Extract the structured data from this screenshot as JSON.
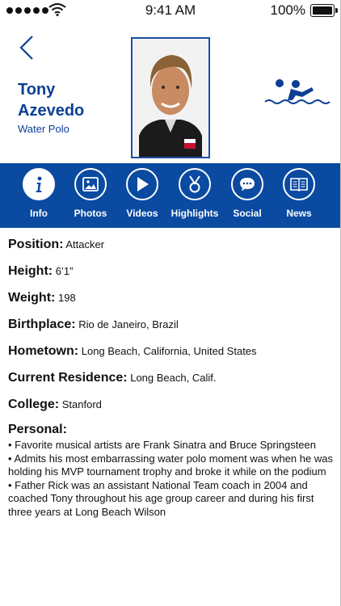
{
  "status_bar": {
    "time": "9:41 AM",
    "battery": "100%"
  },
  "athlete": {
    "first_name": "Tony",
    "last_name": "Azevedo",
    "sport": "Water Polo"
  },
  "tabs": [
    {
      "label": "Info",
      "icon": "info-icon",
      "active": true
    },
    {
      "label": "Photos",
      "icon": "photos-icon",
      "active": false
    },
    {
      "label": "Videos",
      "icon": "play-icon",
      "active": false
    },
    {
      "label": "Highlights",
      "icon": "medal-icon",
      "active": false
    },
    {
      "label": "Social",
      "icon": "chat-icon",
      "active": false
    },
    {
      "label": "News",
      "icon": "book-icon",
      "active": false
    }
  ],
  "info": {
    "position": {
      "label": "Position:",
      "value": "Attacker"
    },
    "height": {
      "label": "Height:",
      "value": "6’1”"
    },
    "weight": {
      "label": "Weight:",
      "value": "198"
    },
    "birthplace": {
      "label": "Birthplace:",
      "value": "Rio de Janeiro, Brazil"
    },
    "hometown": {
      "label": "Hometown:",
      "value": "Long Beach, California, United States"
    },
    "residence": {
      "label": "Current Residence:",
      "value": "Long Beach, Calif."
    },
    "college": {
      "label": "College:",
      "value": "Stanford"
    },
    "personal_label": "Personal:",
    "personal": [
      "• Favorite musical artists are Frank Sinatra and Bruce Springsteen",
      "• Admits his most embarrassing water polo moment was when he was holding his MVP tournament trophy and broke it while on the podium",
      "• Father Rick was an assistant National Team coach in 2004 and coached Tony throughout his age group career and during his first three years at Long Beach Wilson"
    ]
  },
  "colors": {
    "brand_blue": "#0a4aa1",
    "text_blue": "#0c3f96"
  }
}
